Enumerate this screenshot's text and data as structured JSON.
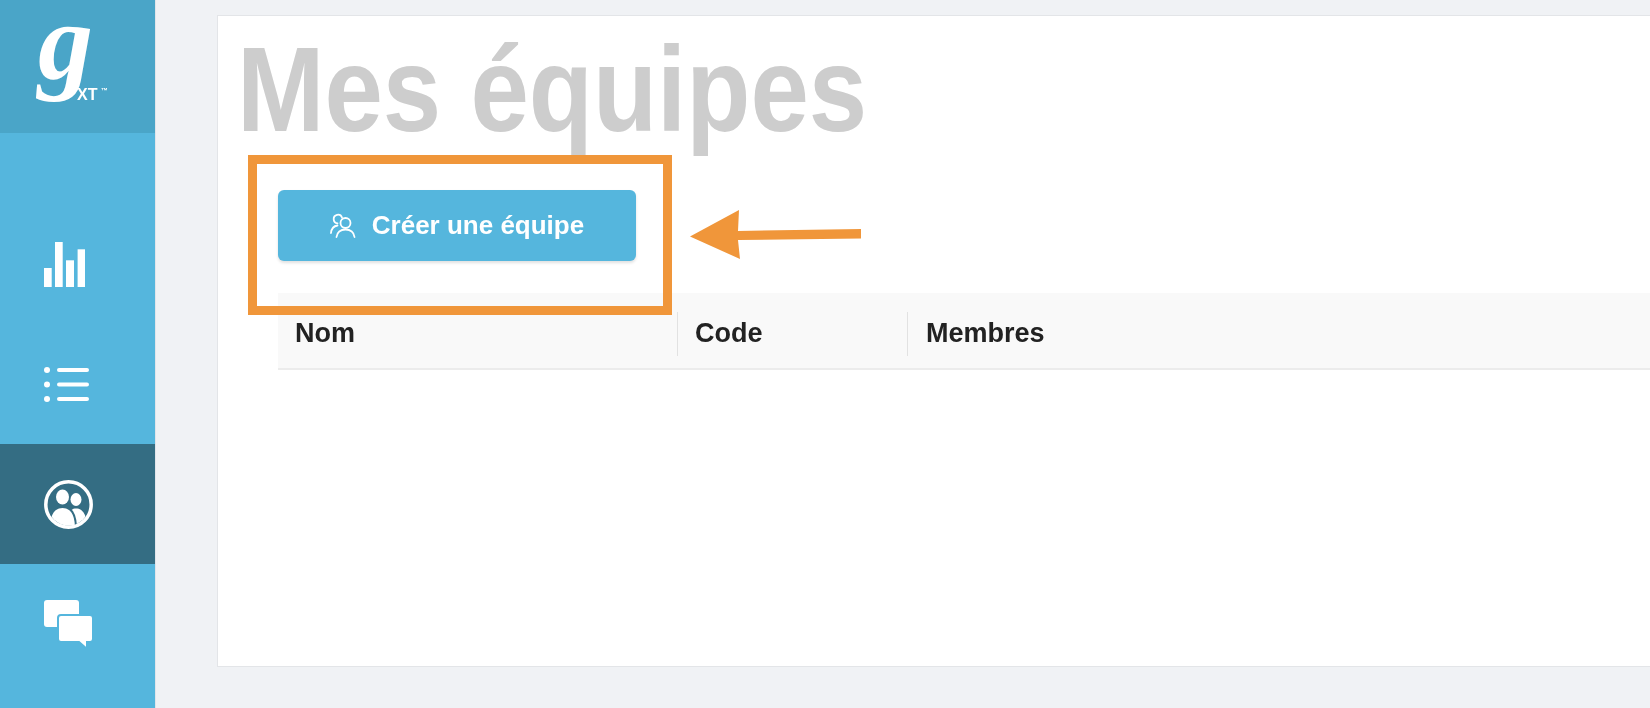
{
  "logo": {
    "mark": "g",
    "suffix": "XT",
    "trademark": "™"
  },
  "sidebar": {
    "items": [
      {
        "kind": "stats",
        "selected": false
      },
      {
        "kind": "list",
        "selected": false
      },
      {
        "kind": "teams",
        "selected": true
      },
      {
        "kind": "messages",
        "selected": false
      }
    ]
  },
  "page": {
    "title": "Mes équipes",
    "create_button": {
      "label": "Créer une équipe"
    }
  },
  "table": {
    "columns": [
      "Nom",
      "Code",
      "Membres"
    ]
  },
  "annotations": [
    {
      "kind": "highlight_frame"
    },
    {
      "kind": "arrow"
    }
  ]
}
